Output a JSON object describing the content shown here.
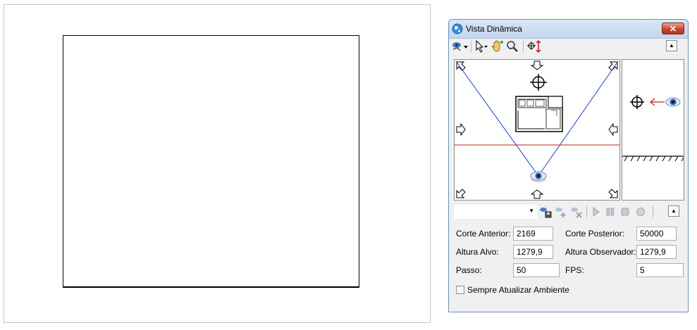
{
  "window": {
    "title": "Vista Dinâmica",
    "close_label": "✕"
  },
  "toolbar": {
    "icons": [
      "eye-mode-icon",
      "pointer-icon",
      "hand-pan-icon",
      "zoom-icon",
      "height-adjust-icon"
    ],
    "collapse_label": "▲"
  },
  "playback": {
    "camera_select_value": "",
    "icons": [
      "save-camera-icon",
      "add-camera-icon",
      "delete-camera-icon",
      "play-icon",
      "pause-icon",
      "stop-icon",
      "record-icon"
    ],
    "collapse_label": "▲"
  },
  "form": {
    "corte_anterior_label": "Corte Anterior:",
    "corte_anterior_value": "2169",
    "corte_posterior_label": "Corte Posterior:",
    "corte_posterior_value": "50000",
    "altura_alvo_label": "Altura Alvo:",
    "altura_alvo_value": "1279,9",
    "altura_observador_label": "Altura Observador:",
    "altura_observador_value": "1279,9",
    "passo_label": "Passo:",
    "passo_value": "50",
    "fps_label": "FPS:",
    "fps_value": "5",
    "sempre_atualizar_label": "Sempre Atualizar Ambiente",
    "sempre_atualizar_checked": false
  },
  "colors": {
    "sight_line": "#1f3fc8",
    "cut_line": "#c02020",
    "title_bar": "#c3d6ee",
    "close_button": "#c8452e"
  }
}
